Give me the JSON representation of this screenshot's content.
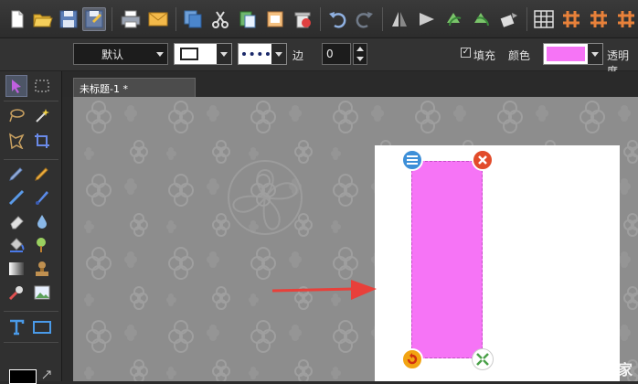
{
  "toolbar": {
    "icons": [
      "new-icon",
      "open-icon",
      "save-icon",
      "save-as-icon",
      "print-icon",
      "email-icon",
      "copy-icon",
      "cut-icon",
      "paste-icon",
      "crop-icon",
      "delete-icon",
      "undo-icon",
      "redo-icon",
      "flip-horizontal-icon",
      "flip-vertical-icon",
      "rotate-left-icon",
      "rotate-right-icon",
      "free-rotate-icon",
      "grid-icon",
      "hash-grid-icon",
      "hash-grid-2-icon",
      "hash-grid-3-icon"
    ]
  },
  "propbar": {
    "font_value": "默认",
    "border_label": "边",
    "border_value": "0",
    "fill_label": "填充",
    "fill_checked": true,
    "color_label": "颜色",
    "fill_color": "#f674f6",
    "opacity_label": "透明度"
  },
  "tabs": [
    {
      "label": "未标题-1 *"
    }
  ],
  "canvas": {
    "background": "#8d8d8d",
    "shape_color": "#f674f6",
    "arrow_color": "#e8403a"
  },
  "watermark": {
    "text": "系统之家"
  }
}
